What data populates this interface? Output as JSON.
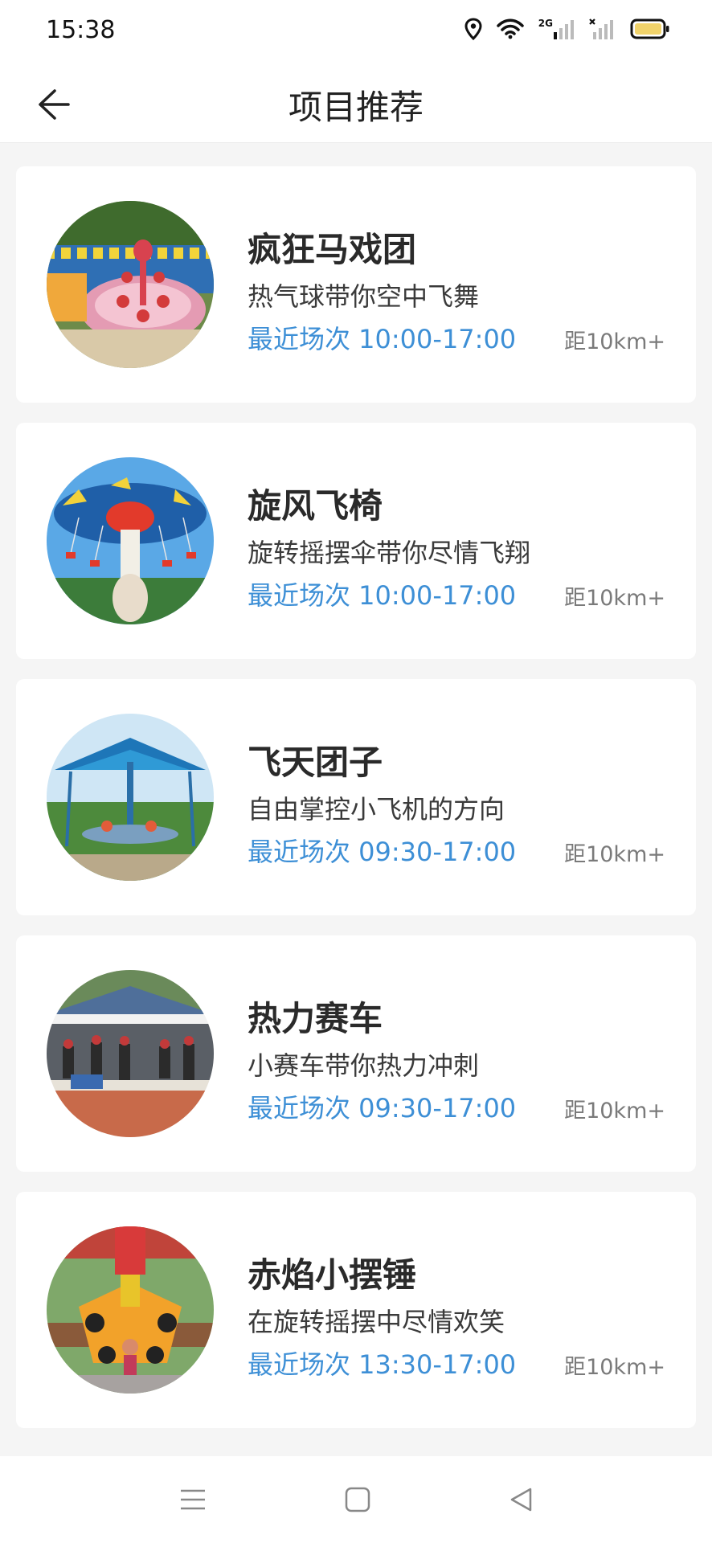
{
  "status_bar": {
    "time": "15:38",
    "network_label": "2G",
    "icons": [
      "location-icon",
      "wifi-icon",
      "signal-icon",
      "signal-off-icon",
      "battery-icon"
    ],
    "battery_color": "#f1d36b"
  },
  "header": {
    "title": "项目推荐",
    "back_icon": "arrow-left-icon"
  },
  "accent_color": "#3d8fd6",
  "attractions": [
    {
      "title": "疯狂马戏团",
      "desc": "热气球带你空中飞舞",
      "session": "最近场次 10:00-17:00",
      "distance": "距10km+"
    },
    {
      "title": "旋风飞椅",
      "desc": "旋转摇摆伞带你尽情飞翔",
      "session": "最近场次 10:00-17:00",
      "distance": "距10km+"
    },
    {
      "title": "飞天团子",
      "desc": "自由掌控小飞机的方向",
      "session": "最近场次 09:30-17:00",
      "distance": "距10km+"
    },
    {
      "title": "热力赛车",
      "desc": "小赛车带你热力冲刺",
      "session": "最近场次 09:30-17:00",
      "distance": "距10km+"
    },
    {
      "title": "赤焰小摆锤",
      "desc": "在旋转摇摆中尽情欢笑",
      "session": "最近场次 13:30-17:00",
      "distance": "距10km+"
    }
  ],
  "nav_bar": {
    "icons": [
      "menu-icon",
      "home-square-icon",
      "back-triangle-icon"
    ]
  }
}
